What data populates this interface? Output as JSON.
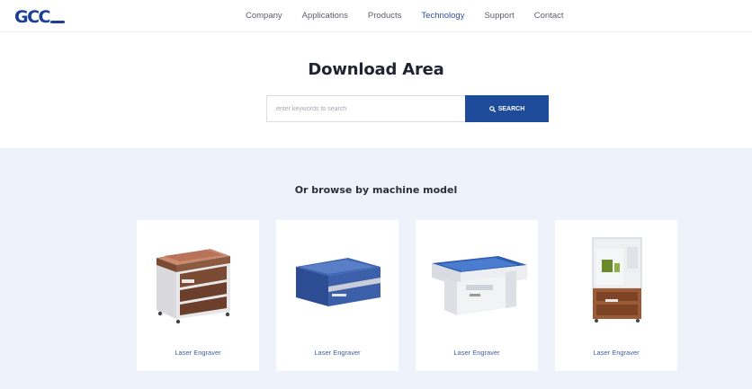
{
  "header": {
    "logo": "GCC",
    "nav": [
      {
        "label": "Company",
        "active": false
      },
      {
        "label": "Applications",
        "active": false
      },
      {
        "label": "Products",
        "active": false
      },
      {
        "label": "Technology",
        "active": true
      },
      {
        "label": "Support",
        "active": false
      },
      {
        "label": "Contact",
        "active": false
      }
    ]
  },
  "download": {
    "title": "Download Area",
    "search": {
      "placeholder": "enter keywords to search",
      "button_label": "SEARCH",
      "button_icon": "search-icon"
    }
  },
  "browse": {
    "title": "Or browse by machine model",
    "cards": [
      {
        "label": "Laser Engraver",
        "image": "laser-engraver-large-copper"
      },
      {
        "label": "Laser Engraver",
        "image": "laser-engraver-blue-desktop"
      },
      {
        "label": "Laser Engraver",
        "image": "laser-engraver-flatbed-blue"
      },
      {
        "label": "Laser Engraver",
        "image": "laser-marker-enclosed"
      }
    ]
  },
  "colors": {
    "brand": "#1b3f94",
    "search_button": "#1e4b9a",
    "browse_background": "#eef3fb",
    "nav_active": "#2e4f9e",
    "card_label": "#3e5fa8"
  }
}
